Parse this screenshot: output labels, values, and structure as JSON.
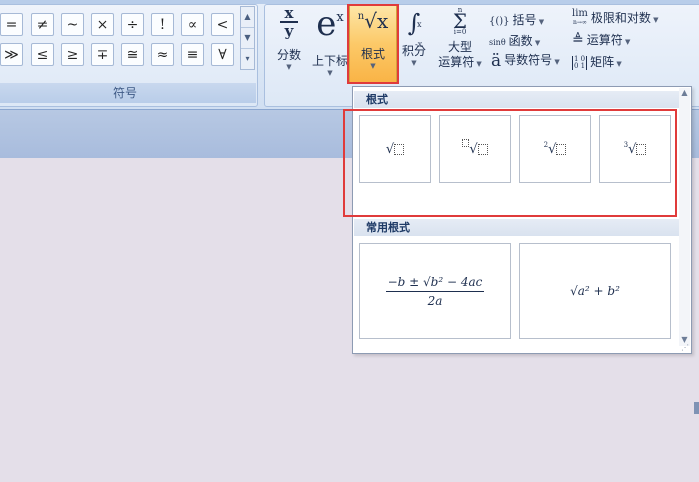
{
  "symbols": {
    "row1": [
      "=",
      "≠",
      "~",
      "×",
      "÷",
      "!",
      "∝",
      "<"
    ],
    "row2": [
      "≫",
      "≤",
      "≥",
      "∓",
      "≅",
      "≈",
      "≡",
      "∀"
    ],
    "group_label": "符号"
  },
  "structures": {
    "fraction": {
      "icon_top": "x",
      "icon_bottom": "y",
      "label": "分数"
    },
    "script": {
      "icon": "e",
      "icon_sup": "x",
      "label": "上下标"
    },
    "radical": {
      "icon_index": "n",
      "icon_body": "√x",
      "label": "根式"
    },
    "integral": {
      "icon": "∫",
      "icon_sup": "x",
      "icon_sub": "-x",
      "label": "积分"
    },
    "large_operator": {
      "icon": "Σ",
      "icon_sup": "n",
      "icon_sub": "i=0",
      "label_line1": "大型",
      "label_line2": "运算符"
    },
    "bracket": {
      "icon": "{()}",
      "label": "括号"
    },
    "function": {
      "icon": "sinθ",
      "label": "函数"
    },
    "accent": {
      "icon": "ä",
      "label": "导数符号"
    },
    "limit_log": {
      "icon": "lim",
      "icon_sub": "n→∞",
      "label": "极限和对数"
    },
    "operator": {
      "icon": "≜",
      "label": "运算符"
    },
    "matrix": {
      "icon": "[1 0 / 0 1]",
      "label": "矩阵"
    }
  },
  "panel": {
    "section1_title": "根式",
    "section2_title": "常用根式",
    "templates": [
      {
        "name": "square-root"
      },
      {
        "name": "nth-root"
      },
      {
        "name": "square-root-index",
        "index": "2"
      },
      {
        "name": "cube-root",
        "index": "3"
      }
    ],
    "common": [
      {
        "name": "quadratic-formula",
        "numerator": "−b ± √b² − 4ac",
        "denominator": "2a"
      },
      {
        "name": "pythagorean-root",
        "expr": "√a² + b²"
      }
    ]
  },
  "colors": {
    "highlight": "#fcc968",
    "red_outline": "#e03b3b",
    "ribbon_bg": "#dae6f5"
  }
}
